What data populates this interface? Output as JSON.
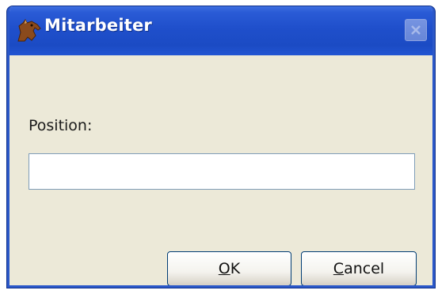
{
  "window": {
    "title": "Mitarbeiter",
    "app_icon": "horse-icon",
    "close_icon": "close-icon"
  },
  "form": {
    "position_label": "Position:",
    "position_value": ""
  },
  "buttons": {
    "ok_mnemonic": "O",
    "ok_rest": "K",
    "cancel_mnemonic": "C",
    "cancel_rest": "ancel"
  },
  "colors": {
    "titlebar": "#1f4fcb",
    "dialog_background": "#ece9d8",
    "button_border": "#003c74"
  }
}
